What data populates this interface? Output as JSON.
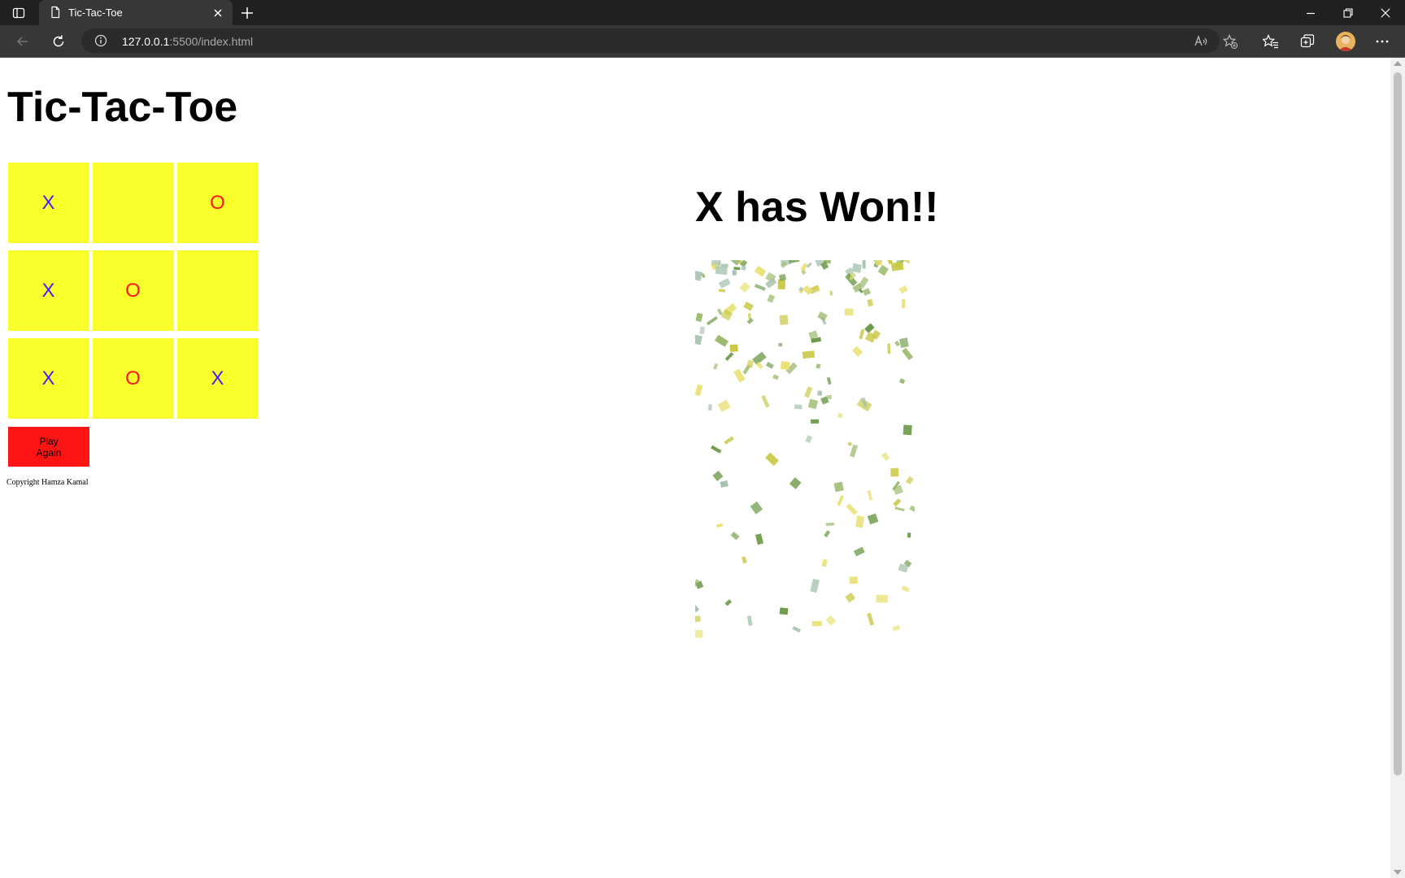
{
  "browser": {
    "tab_title": "Tic-Tac-Toe",
    "url_host": "127.0.0.1",
    "url_rest": ":5500/index.html",
    "toolbar_icons": [
      "back-icon",
      "refresh-icon",
      "read-aloud-icon",
      "add-favorite-icon",
      "favorites-icon",
      "collections-icon",
      "profile-avatar",
      "more-icon"
    ],
    "window_controls": [
      "minimize-icon",
      "restore-icon",
      "close-icon"
    ]
  },
  "page": {
    "title": "Tic-Tac-Toe",
    "board": [
      "X",
      "",
      "O",
      "X",
      "O",
      "",
      "X",
      "O",
      "X"
    ],
    "play_again_line1": "Play",
    "play_again_line2": "Again",
    "copyright": "Copyright Hamza Kamal",
    "result": "X has Won!!"
  },
  "colors": {
    "cell_background": "#f8ff2b",
    "x_mark": "#4a1ef0",
    "o_mark": "#ff1414",
    "play_again_background": "#ff1414",
    "confetti": [
      "#6b9a48",
      "#c9c846",
      "#9ab86a",
      "#e8e070",
      "#a7c3b0"
    ]
  }
}
